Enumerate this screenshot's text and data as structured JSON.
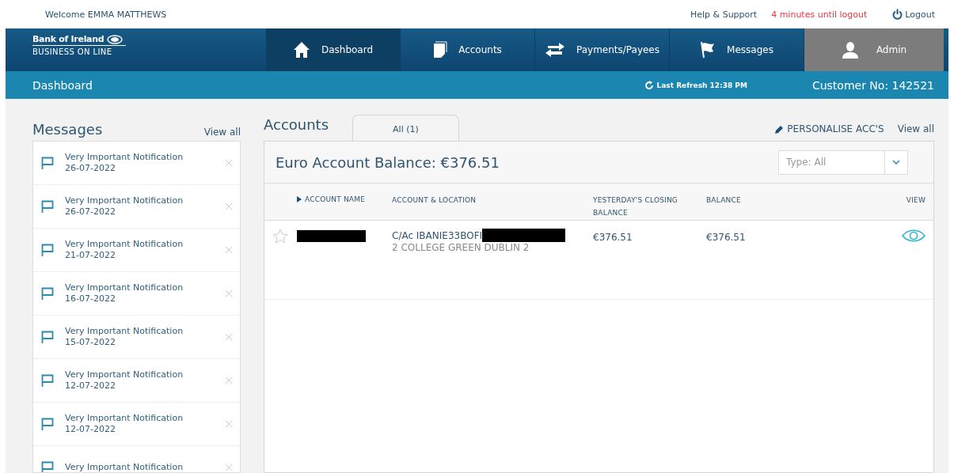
{
  "top_bar": {
    "welcome": "Welcome EMMA MATTHEWS",
    "help": "Help & Support",
    "timeout": "4 minutes until logout",
    "logout": "Logout"
  },
  "brand": {
    "name": "Bank of Ireland",
    "subtitle": "BUSINESS ON LINE"
  },
  "nav": [
    {
      "label": "Dashboard",
      "selected": true,
      "kind": "tab"
    },
    {
      "label": "Accounts",
      "selected": false,
      "kind": "tab"
    },
    {
      "label": "Payments/Payees",
      "selected": false,
      "kind": "tab"
    },
    {
      "label": "Messages",
      "selected": false,
      "kind": "tab"
    },
    {
      "label": "Admin",
      "selected": false,
      "kind": "admin"
    }
  ],
  "sub_bar": {
    "title": "Dashboard",
    "refresh": "Last Refresh 12:38 PM",
    "customer": "Customer No: 142521"
  },
  "messages": {
    "title": "Messages",
    "view_all": "View all",
    "items": [
      {
        "title": "Very Important Notification",
        "date": "26-07-2022"
      },
      {
        "title": "Very Important Notification",
        "date": "26-07-2022"
      },
      {
        "title": "Very Important Notification",
        "date": "21-07-2022"
      },
      {
        "title": "Very Important Notification",
        "date": "16-07-2022"
      },
      {
        "title": "Very Important Notification",
        "date": "15-07-2022"
      },
      {
        "title": "Very Important Notification",
        "date": "12-07-2022"
      },
      {
        "title": "Very Important Notification",
        "date": "12-07-2022"
      },
      {
        "title": "Very Important Notification"
      }
    ]
  },
  "accounts": {
    "title": "Accounts",
    "tabs": [
      {
        "label": "All (1)",
        "selected": true
      }
    ],
    "personalise": "PERSONALISE ACC'S",
    "view_all": "View all",
    "balance": "Euro Account Balance: €376.51",
    "type_filter": {
      "value": "Type: All"
    },
    "columns": [
      "ACCOUNT NAME",
      "ACCOUNT & LOCATION",
      "YESTERDAY'S CLOSING BALANCE",
      "BALANCE",
      "VIEW"
    ],
    "rows": [
      {
        "starred": false,
        "account": "C/Ac IBANIE33BOFI",
        "location": "2 COLLEGE GREEN DUBLIN 2",
        "closing": "€376.51",
        "balance": "€376.51"
      }
    ]
  }
}
